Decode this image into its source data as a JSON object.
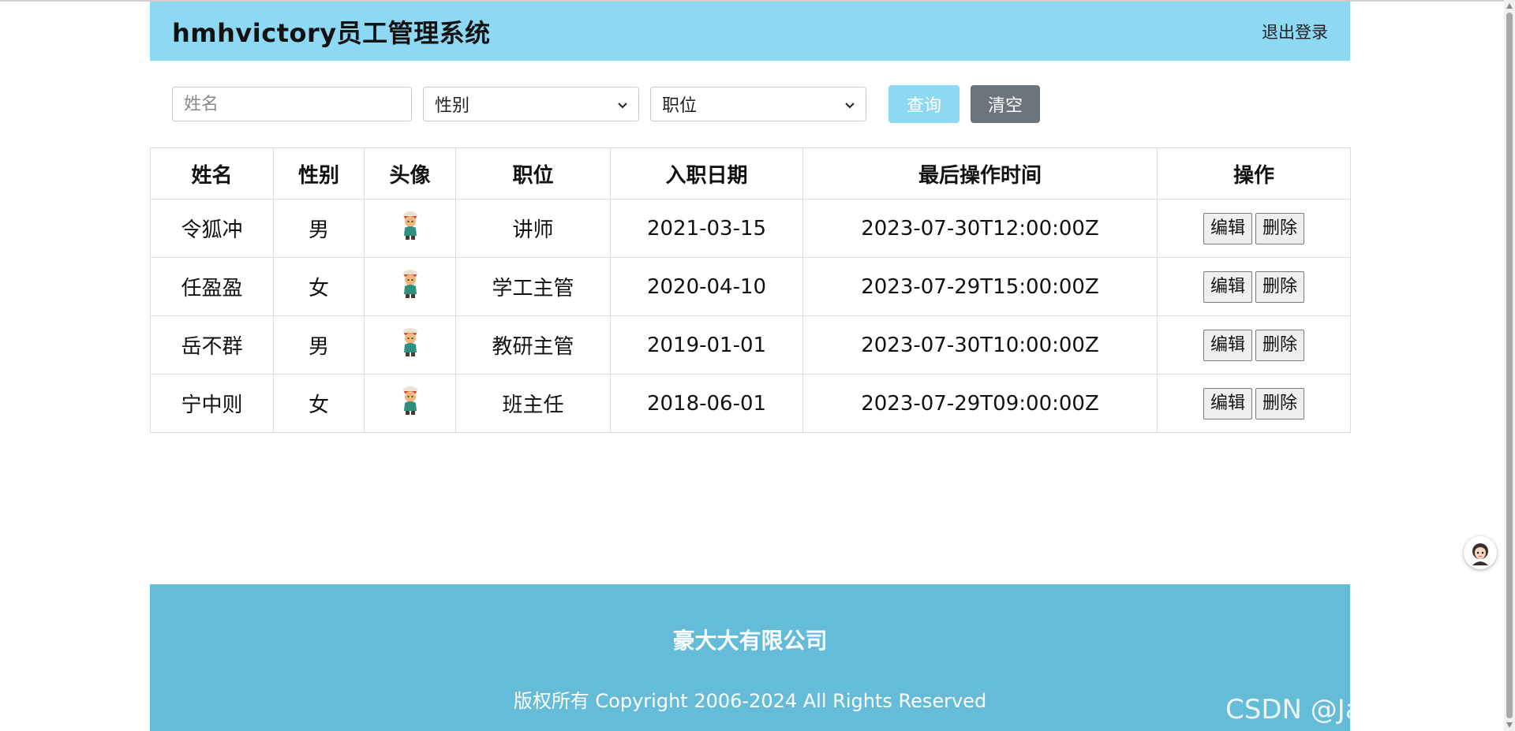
{
  "header": {
    "title": "hmhvictory员工管理系统",
    "logout_label": "退出登录",
    "bg_color": "#8dd9f4"
  },
  "search": {
    "name_placeholder": "姓名",
    "gender_select_value": "性别",
    "job_select_value": "职位",
    "query_label": "查询",
    "clear_label": "清空"
  },
  "table": {
    "columns": [
      "姓名",
      "性别",
      "头像",
      "职位",
      "入职日期",
      "最后操作时间",
      "操作"
    ],
    "rows": [
      {
        "name": "令狐冲",
        "gender": "男",
        "avatar": "avatar-icon",
        "job": "讲师",
        "entry_date": "2021-03-15",
        "update_time": "2023-07-30T12:00:00Z",
        "edit_label": "编辑",
        "delete_label": "删除"
      },
      {
        "name": "任盈盈",
        "gender": "女",
        "avatar": "avatar-icon",
        "job": "学工主管",
        "entry_date": "2020-04-10",
        "update_time": "2023-07-29T15:00:00Z",
        "edit_label": "编辑",
        "delete_label": "删除"
      },
      {
        "name": "岳不群",
        "gender": "男",
        "avatar": "avatar-icon",
        "job": "教研主管",
        "entry_date": "2019-01-01",
        "update_time": "2023-07-30T10:00:00Z",
        "edit_label": "编辑",
        "delete_label": "删除"
      },
      {
        "name": "宁中则",
        "gender": "女",
        "avatar": "avatar-icon",
        "job": "班主任",
        "entry_date": "2018-06-01",
        "update_time": "2023-07-29T09:00:00Z",
        "edit_label": "编辑",
        "delete_label": "删除"
      }
    ]
  },
  "footer": {
    "company": "豪大大有限公司",
    "copyright": "版权所有 Copyright 2006-2024 All Rights Reserved",
    "bg_color": "#64bcd9"
  },
  "watermark": "CSDN @Java永无止境"
}
